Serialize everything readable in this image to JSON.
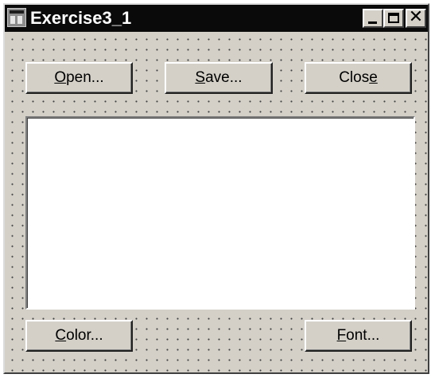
{
  "window": {
    "title": "Exercise3_1",
    "icon": "form-window-icon",
    "controls": {
      "minimize_icon": "minimize-icon",
      "maximize_icon": "maximize-icon",
      "close_icon": "close-icon",
      "close_glyph": "✕"
    }
  },
  "toolbar": {
    "open": {
      "pre": "",
      "key": "O",
      "post": "pen..."
    },
    "save": {
      "pre": "",
      "key": "S",
      "post": "ave..."
    },
    "close": {
      "pre": "Clos",
      "key": "e",
      "post": ""
    }
  },
  "text_area": {
    "value": ""
  },
  "bottom": {
    "color": {
      "pre": "",
      "key": "C",
      "post": "olor..."
    },
    "font": {
      "pre": "",
      "key": "F",
      "post": "ont..."
    }
  },
  "colors": {
    "title_bar": "#0a0a0a",
    "window_face": "#d4d0c8",
    "text_area": "#ffffff",
    "grid_dots": "#404040"
  }
}
